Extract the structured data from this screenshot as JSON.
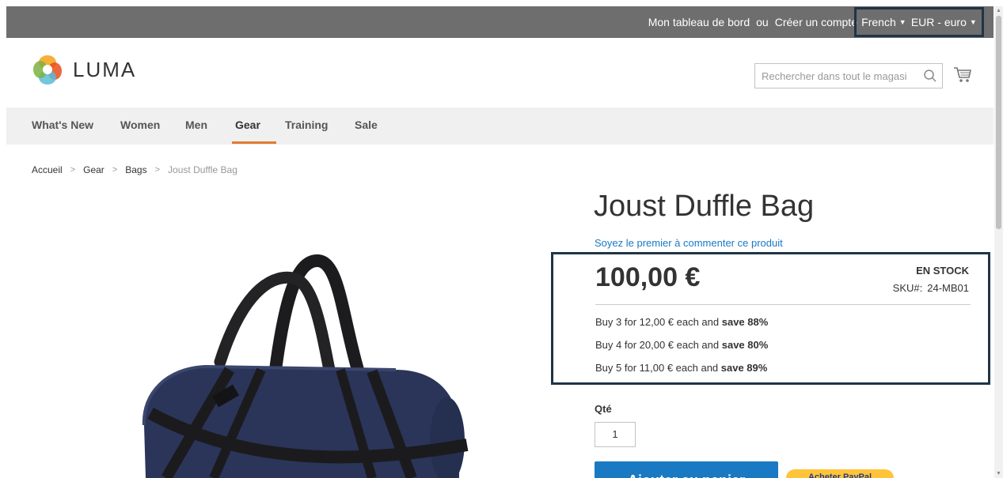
{
  "top_links": {
    "dashboard": "Mon tableau de bord",
    "or": "ou",
    "create_account": "Créer un compte"
  },
  "switchers": {
    "language": "French",
    "currency": "EUR - euro"
  },
  "header": {
    "logo_text": "LUMA",
    "search_placeholder": "Rechercher dans tout le magasi"
  },
  "nav": {
    "items": [
      "What's New",
      "Women",
      "Men",
      "Gear",
      "Training",
      "Sale"
    ],
    "active": "Gear"
  },
  "breadcrumb": {
    "items": [
      "Accueil",
      "Gear",
      "Bags",
      "Joust Duffle Bag"
    ]
  },
  "product": {
    "title": "Joust Duffle Bag",
    "review_link": "Soyez le premier à commenter ce produit",
    "price": "100,00 €",
    "stock": "EN STOCK",
    "sku_label": "SKU#:",
    "sku_value": "24-MB01",
    "tiers": [
      {
        "text": "Buy 3 for 12,00 € each and ",
        "save": "save 88%"
      },
      {
        "text": "Buy 4 for 20,00 € each and ",
        "save": "save 80%"
      },
      {
        "text": "Buy 5 for 11,00 € each and ",
        "save": "save 89%"
      }
    ],
    "qty_label": "Qté",
    "qty_value": "1",
    "add_to_cart": "Ajouter au panier",
    "paypal": "Acheter PayPal"
  },
  "colors": {
    "topbar": "#6e6e6e",
    "highlight_border": "#1f3447",
    "link": "#1979c3",
    "nav_active": "#e07b30",
    "paypal": "#ffc439"
  }
}
